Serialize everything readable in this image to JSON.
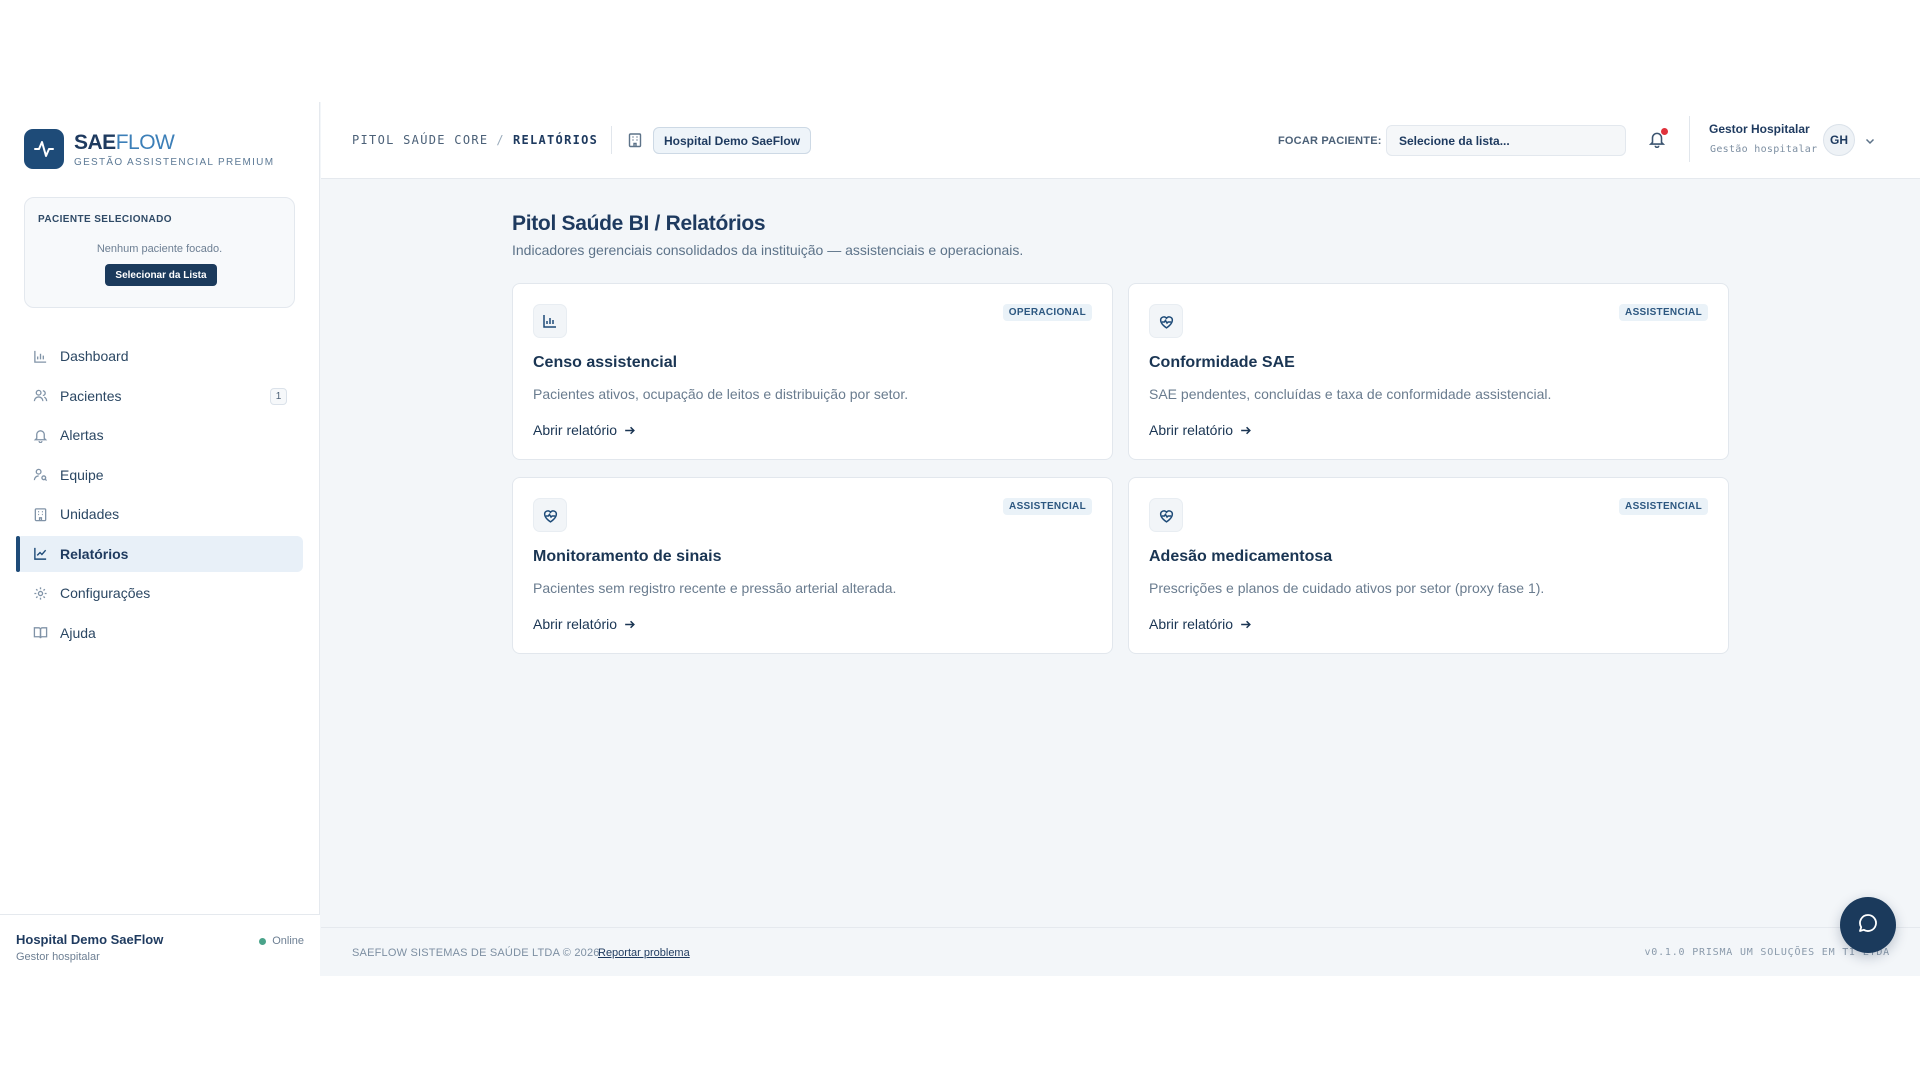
{
  "brand": {
    "name_a": "SAE",
    "name_b": "FLOW",
    "subtitle": "GESTÃO ASSISTENCIAL PREMIUM"
  },
  "patient_panel": {
    "title": "PACIENTE SELECIONADO",
    "empty_text": "Nenhum paciente focado.",
    "button_label": "Selecionar da Lista"
  },
  "nav": [
    {
      "label": "Dashboard",
      "icon": "bar-chart-icon"
    },
    {
      "label": "Pacientes",
      "icon": "users-icon",
      "badge": "1"
    },
    {
      "label": "Alertas",
      "icon": "bell-icon"
    },
    {
      "label": "Equipe",
      "icon": "team-icon"
    },
    {
      "label": "Unidades",
      "icon": "building-icon"
    },
    {
      "label": "Relatórios",
      "icon": "line-chart-icon",
      "active": true
    },
    {
      "label": "Configurações",
      "icon": "gear-icon"
    },
    {
      "label": "Ajuda",
      "icon": "book-icon"
    }
  ],
  "side_footer": {
    "hospital": "Hospital Demo SaeFlow",
    "role": "Gestor hospitalar",
    "status": "Online"
  },
  "header": {
    "breadcrumb_root": "PITOL SAÚDE CORE",
    "breadcrumb_sep": "/",
    "breadcrumb_current": "RELATÓRIOS",
    "hospital_pill": "Hospital Demo SaeFlow",
    "focus_label": "FOCAR PACIENTE:",
    "focus_placeholder": "Selecione da lista...",
    "user_name": "Gestor Hospitalar",
    "user_role": "Gestão hospitalar",
    "user_initials": "GH"
  },
  "main": {
    "title": "Pitol Saúde BI / Relatórios",
    "subtitle": "Indicadores gerenciais consolidados da instituição — assistenciais e operacionais.",
    "cards": [
      {
        "tag": "OPERACIONAL",
        "title": "Censo assistencial",
        "desc": "Pacientes ativos, ocupação de leitos e distribuição por setor.",
        "link": "Abrir relatório",
        "icon": "bar-chart-icon"
      },
      {
        "tag": "ASSISTENCIAL",
        "title": "Conformidade SAE",
        "desc": "SAE pendentes, concluídas e taxa de conformidade assistencial.",
        "link": "Abrir relatório",
        "icon": "heart-pulse-icon"
      },
      {
        "tag": "ASSISTENCIAL",
        "title": "Monitoramento de sinais",
        "desc": "Pacientes sem registro recente e pressão arterial alterada.",
        "link": "Abrir relatório",
        "icon": "heart-pulse-icon"
      },
      {
        "tag": "ASSISTENCIAL",
        "title": "Adesão medicamentosa",
        "desc": "Prescrições e planos de cuidado ativos por setor (proxy fase 1).",
        "link": "Abrir relatório",
        "icon": "heart-pulse-icon"
      }
    ]
  },
  "footer": {
    "copyright": "SAEFLOW SISTEMAS DE SAÚDE LTDA © 2026",
    "report_link": "Reportar problema",
    "version": "v0.1.0  PRISMA UM SOLUÇÕES EM TI LTDA"
  },
  "colors": {
    "primary": "#1e4b78",
    "accent": "#3c7fb8",
    "alert": "#e0323c",
    "online": "#4aa38a"
  }
}
